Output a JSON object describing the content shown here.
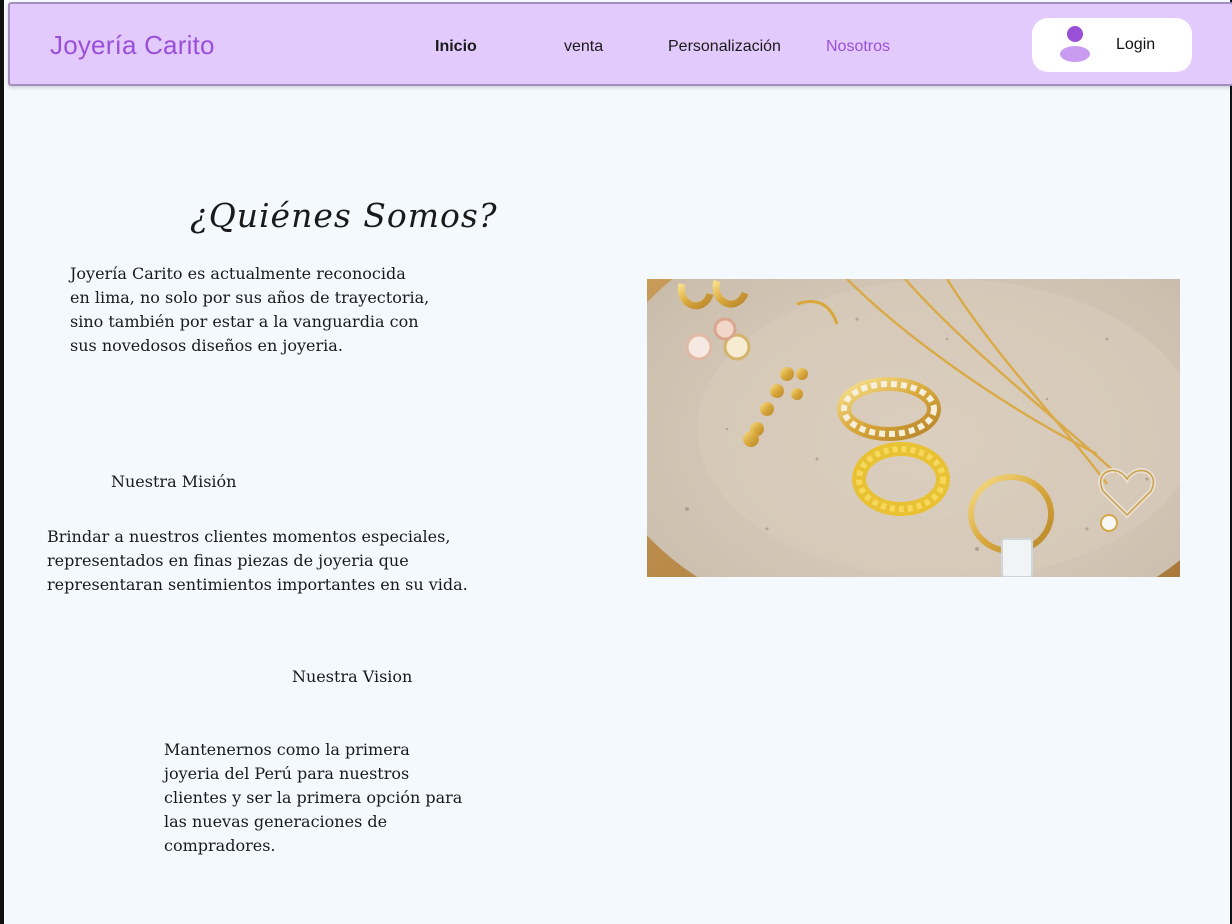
{
  "header": {
    "brand": "Joyería Carito",
    "nav": [
      "Inicio",
      "venta",
      "Personalización",
      "Nosotros"
    ],
    "active": "Nosotros",
    "login_label": "Login"
  },
  "about": {
    "title": "¿Quiénes Somos?",
    "intro": "Joyería Carito es actualmente reconocida en lima, no solo por sus años de trayectoria, sino también por estar a la vanguardia con sus novedosos diseños en joyeria.",
    "mission_heading": "Nuestra Misión",
    "mission_text": "Brindar a nuestros clientes momentos especiales, representados en finas piezas de joyeria que representaran sentimientos importantes en su vida.",
    "vision_heading": "Nuestra Vision",
    "vision_text": "Mantenernos como la primera joyeria del Perú para nuestros clientes y ser la primera opción para las nuevas generaciones de compradores."
  },
  "colors": {
    "nav_bg": "#e3cafd",
    "brand": "#9a4fd9",
    "page_bg": "#f4f9fe"
  },
  "image": {
    "subject": "gold jewelry on ceramic plate"
  }
}
